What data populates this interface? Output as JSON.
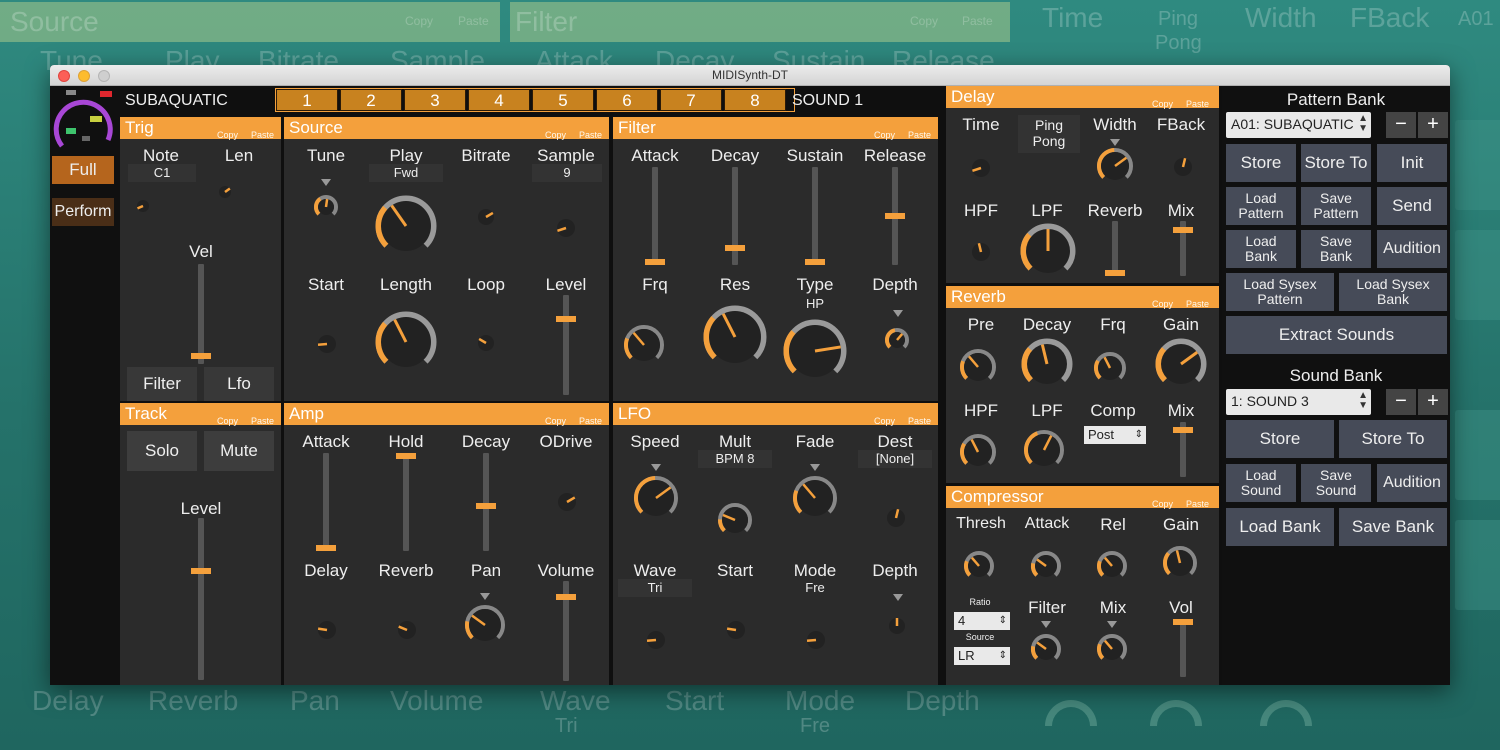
{
  "window_title": "MIDISynth-DT",
  "colors": {
    "accent": "#f4a03c",
    "panel": "#2b2b2b",
    "button": "#464b58",
    "background": "#0f0f0f"
  },
  "background": {
    "top_labels": [
      "Source",
      "Copy",
      "Paste",
      "Filter",
      "Copy",
      "Paste",
      "Time",
      "Ping",
      "Pong",
      "Width",
      "FBack",
      "A01"
    ],
    "second_row": [
      "Tune",
      "Play",
      "Bitrate",
      "Sample",
      "Attack",
      "Decay",
      "Sustain",
      "Release"
    ],
    "bottom_labels": [
      "Delay",
      "Reverb",
      "Pan",
      "Volume",
      "Wave",
      "Tri",
      "Start",
      "Mode",
      "Fre",
      "Depth"
    ]
  },
  "sidebar": {
    "full_label": "Full",
    "perform_label": "Perform"
  },
  "header": {
    "pattern_name": "SUBAQUATIC",
    "tabs": [
      "1",
      "2",
      "3",
      "4",
      "5",
      "6",
      "7",
      "8"
    ],
    "sound_label": "SOUND 1"
  },
  "trig": {
    "title": "Trig",
    "copy": "Copy",
    "paste": "Paste",
    "note_label": "Note",
    "note_value": "C1",
    "len_label": "Len",
    "vel_label": "Vel",
    "vel_value": 0.05,
    "filter_btn": "Filter",
    "lfo_btn": "Lfo"
  },
  "track": {
    "title": "Track",
    "copy": "Copy",
    "paste": "Paste",
    "solo": "Solo",
    "mute": "Mute",
    "level_label": "Level",
    "level_value": 0.68
  },
  "source": {
    "title": "Source",
    "copy": "Copy",
    "paste": "Paste",
    "tune": "Tune",
    "play": "Play",
    "play_value": "Fwd",
    "bitrate": "Bitrate",
    "sample": "Sample",
    "sample_value": "9",
    "start": "Start",
    "length": "Length",
    "loop": "Loop",
    "level": "Level",
    "level_value": 0.78
  },
  "filter": {
    "title": "Filter",
    "copy": "Copy",
    "paste": "Paste",
    "attack": "Attack",
    "decay": "Decay",
    "sustain": "Sustain",
    "release": "Release",
    "slider_values": [
      0.0,
      0.15,
      0.0,
      0.5
    ],
    "frq": "Frq",
    "res": "Res",
    "type": "Type",
    "type_value": "HP",
    "depth": "Depth"
  },
  "amp": {
    "title": "Amp",
    "copy": "Copy",
    "paste": "Paste",
    "attack": "Attack",
    "hold": "Hold",
    "decay": "Decay",
    "odrive": "ODrive",
    "slider_values": [
      0.0,
      1.0,
      0.46
    ],
    "delay": "Delay",
    "reverb": "Reverb",
    "pan": "Pan",
    "volume": "Volume",
    "volume_value": 0.86
  },
  "lfo": {
    "title": "LFO",
    "copy": "Copy",
    "paste": "Paste",
    "speed": "Speed",
    "mult": "Mult",
    "mult_value": "BPM 8",
    "fade": "Fade",
    "dest": "Dest",
    "dest_value": "[None]",
    "wave": "Wave",
    "wave_value": "Tri",
    "start": "Start",
    "mode": "Mode",
    "mode_value": "Fre",
    "depth": "Depth"
  },
  "delay": {
    "title": "Delay",
    "copy": "Copy",
    "paste": "Paste",
    "time": "Time",
    "ping_pong": "Ping\nPong",
    "width": "Width",
    "fback": "FBack",
    "hpf": "HPF",
    "lpf": "LPF",
    "reverb": "Reverb",
    "mix": "Mix",
    "reverb_value": 0.0,
    "mix_value": 0.88
  },
  "reverb": {
    "title": "Reverb",
    "copy": "Copy",
    "paste": "Paste",
    "pre": "Pre",
    "decay": "Decay",
    "frq": "Frq",
    "gain": "Gain",
    "hpf": "HPF",
    "lpf": "LPF",
    "comp": "Comp",
    "comp_value": "Post",
    "mix": "Mix",
    "mix_value": 0.9
  },
  "compressor": {
    "title": "Compressor",
    "copy": "Copy",
    "paste": "Paste",
    "thresh": "Thresh",
    "attack": "Attack",
    "rel": "Rel",
    "gain": "Gain",
    "ratio_label": "Ratio",
    "ratio_value": "4",
    "source_label": "Source",
    "source_value": "LR",
    "filter": "Filter",
    "mix": "Mix",
    "vol": "Vol",
    "vol_value": 1.0
  },
  "pattern_bank": {
    "title": "Pattern Bank",
    "selected": "A01: SUBAQUATIC",
    "minus": "−",
    "plus": "+",
    "store": "Store",
    "store_to": "Store To",
    "init": "Init",
    "load_pattern": "Load\nPattern",
    "save_pattern": "Save\nPattern",
    "send": "Send",
    "load_bank": "Load\nBank",
    "save_bank": "Save\nBank",
    "audition": "Audition",
    "load_sysex_pattern": "Load Sysex\nPattern",
    "load_sysex_bank": "Load Sysex\nBank",
    "extract_sounds": "Extract Sounds"
  },
  "sound_bank": {
    "title": "Sound Bank",
    "selected": "1: SOUND 3",
    "minus": "−",
    "plus": "+",
    "store": "Store",
    "store_to": "Store To",
    "load_sound": "Load\nSound",
    "save_sound": "Save\nSound",
    "audition": "Audition",
    "load_bank": "Load Bank",
    "save_bank": "Save Bank"
  }
}
